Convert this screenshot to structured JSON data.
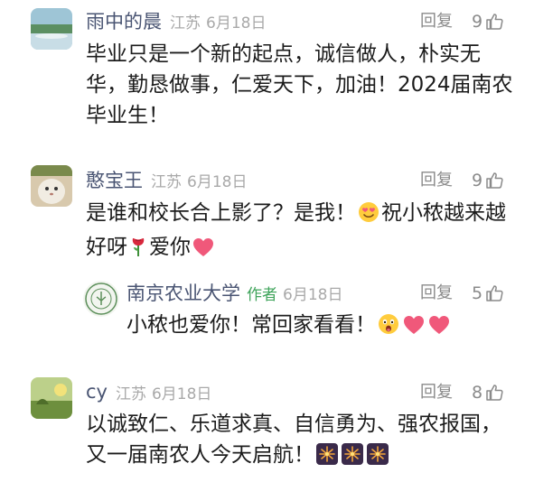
{
  "comments": [
    {
      "username": "雨中的晨",
      "location": "江苏",
      "date": "6月18日",
      "reply_label": "回复",
      "likes": "9",
      "lines": [
        "毕业只是一个新的起点，诚信做人，朴实无",
        "华，勤恳做事，仁爱天下，加油！2024届南农",
        "毕业生！"
      ]
    },
    {
      "username": "憨宝王",
      "location": "江苏",
      "date": "6月18日",
      "reply_label": "回复",
      "likes": "9",
      "line1_a": "是谁和校长合上影了？是我！",
      "line1_b": "祝小秾越来越",
      "line2_a": "好呀",
      "line2_b": "爱你",
      "emojis": [
        "heart-eyes-emoji",
        "rose-emoji",
        "heart-emoji"
      ]
    },
    {
      "username": "南京农业大学",
      "author_tag": "作者",
      "date": "6月18日",
      "reply_label": "回复",
      "likes": "5",
      "text": "小秾也爱你！常回家看看！",
      "emojis": [
        "wow-emoji",
        "heart-emoji",
        "heart-emoji"
      ]
    },
    {
      "username": "cy",
      "location": "江苏",
      "date": "6月18日",
      "reply_label": "回复",
      "likes": "8",
      "lines": [
        "以诚致仁、乐道求真、自信勇为、强农报国，",
        "又一届南农人今天启航！"
      ],
      "emojis": [
        "fireworks-emoji",
        "fireworks-emoji",
        "fireworks-emoji"
      ]
    }
  ],
  "colors": {
    "username": "#4a5573",
    "author_tag": "#3fa45b",
    "meta": "#a9a9a9",
    "heart": "#f0587a"
  }
}
